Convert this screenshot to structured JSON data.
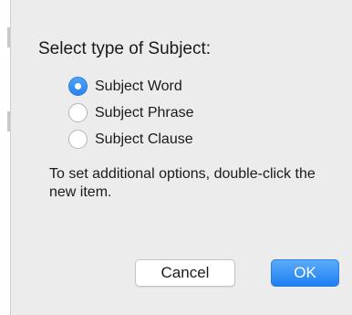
{
  "dialog": {
    "title": "Select type of Subject:",
    "options": [
      {
        "label": "Subject Word",
        "selected": true
      },
      {
        "label": "Subject Phrase",
        "selected": false
      },
      {
        "label": "Subject Clause",
        "selected": false
      }
    ],
    "info_text": "To set additional options, double-click the new item.",
    "buttons": {
      "cancel_label": "Cancel",
      "ok_label": "OK"
    }
  },
  "colors": {
    "dialog_background": "#ececec",
    "accent": "#2a84f0"
  }
}
